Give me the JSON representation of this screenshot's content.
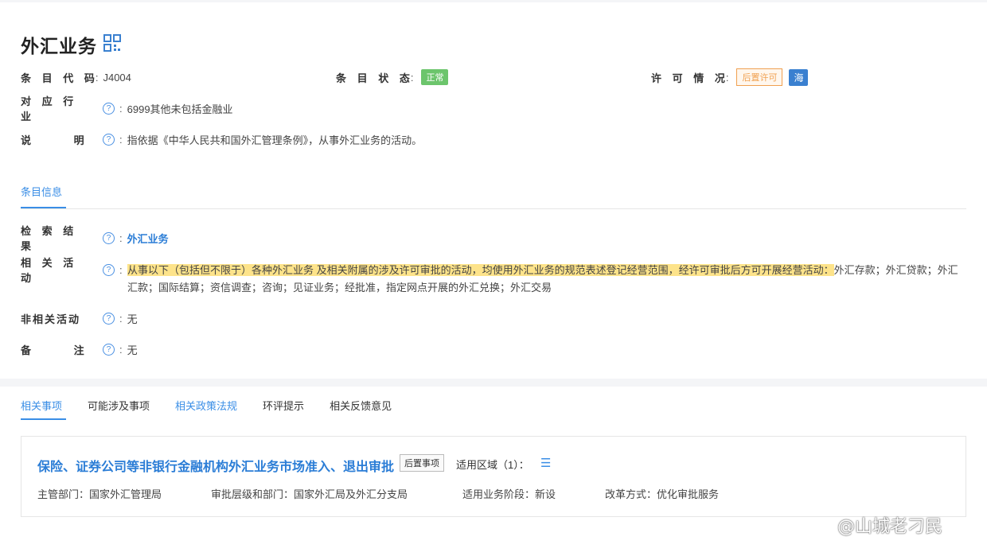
{
  "header": {
    "title": "外汇业务",
    "code_label": "条 目 代 码",
    "code_value": "J4004",
    "status_label": "条 目 状 态",
    "status_value": "正常",
    "license_label": "许 可 情 况",
    "license_value": "后置许可",
    "license_tag": "海"
  },
  "industry": {
    "label": "对 应 行 业",
    "value": "6999其他未包括金融业"
  },
  "description": {
    "label": "说 明",
    "value": "指依据《中华人民共和国外汇管理条例》，从事外汇业务的活动。"
  },
  "info_tab": "条目信息",
  "search_result": {
    "label": "检 索 结 果",
    "value": "外汇业务"
  },
  "related_activity": {
    "label": "相 关 活 动",
    "highlighted": "从事以下（包括但不限于）各种外汇业务 及相关附属的涉及许可审批的活动，均使用外汇业务的规范表述登记经营范围，经许可审批后方可开展经营活动：",
    "rest": "外汇存款；外汇贷款；外汇汇款；国际结算；资信调查；咨询；见证业务；经批准，指定网点开展的外汇兑换；外汇交易"
  },
  "non_related": {
    "label": "非相关活动",
    "value": "无"
  },
  "remark": {
    "label": "备 注",
    "value": "无"
  },
  "tabs": [
    "相关事项",
    "可能涉及事项",
    "相关政策法规",
    "环评提示",
    "相关反馈意见"
  ],
  "item": {
    "title": "保险、证券公司等非银行金融机构外汇业务市场准入、退出审批",
    "tag": "后置事项",
    "region": "适用区域（1）：",
    "dept": "主管部门：国家外汇管理局",
    "level": "审批层级和部门：国家外汇局及外汇分支局",
    "stage": "适用业务阶段：新设",
    "reform": "改革方式：优化审批服务"
  },
  "watermark": "@山城老刁民",
  "colors": {
    "accent": "#3a8ee6",
    "highlight": "#fde38a",
    "status_green": "#6cc56c",
    "license_orange": "#f0a050"
  }
}
